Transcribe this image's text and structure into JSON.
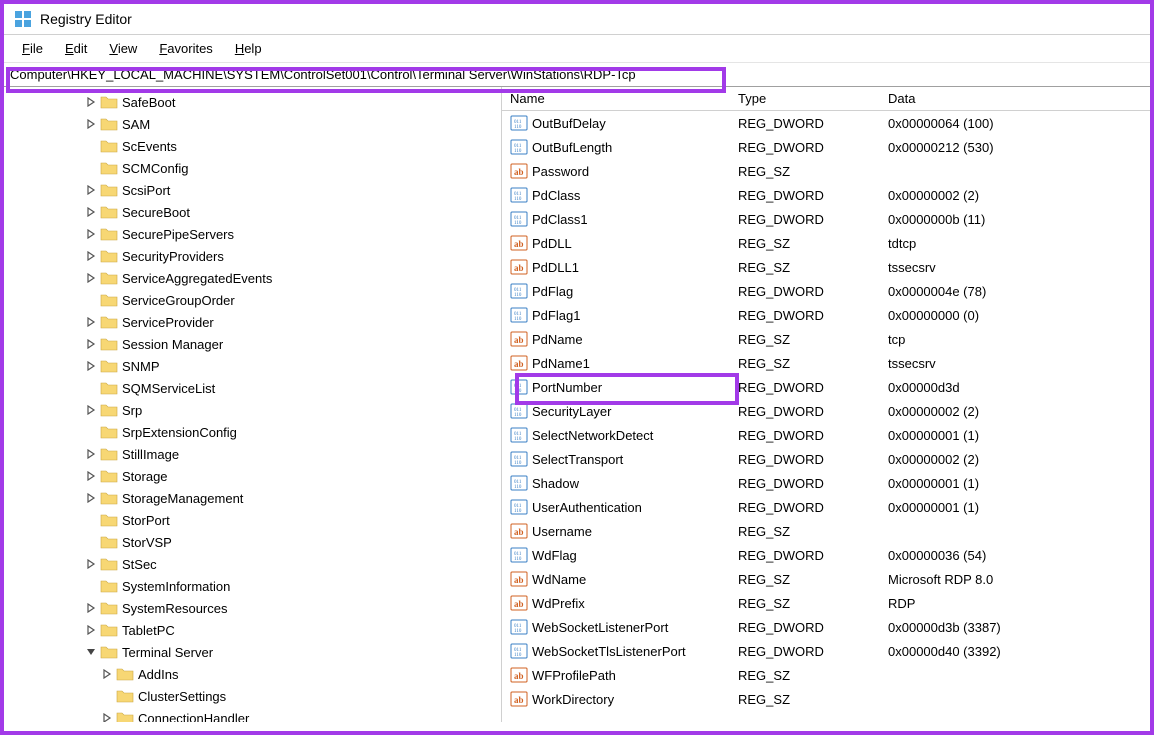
{
  "app": {
    "title": "Registry Editor"
  },
  "menu": {
    "file": "File",
    "edit": "Edit",
    "view": "View",
    "favorites": "Favorites",
    "help": "Help"
  },
  "address": "Computer\\HKEY_LOCAL_MACHINE\\SYSTEM\\ControlSet001\\Control\\Terminal Server\\WinStations\\RDP-Tcp",
  "columns": {
    "name": "Name",
    "type": "Type",
    "data": "Data"
  },
  "tree": [
    {
      "depth": 5,
      "exp": ">",
      "label": "SafeBoot"
    },
    {
      "depth": 5,
      "exp": ">",
      "label": "SAM"
    },
    {
      "depth": 5,
      "exp": "",
      "label": "ScEvents"
    },
    {
      "depth": 5,
      "exp": "",
      "label": "SCMConfig"
    },
    {
      "depth": 5,
      "exp": ">",
      "label": "ScsiPort"
    },
    {
      "depth": 5,
      "exp": ">",
      "label": "SecureBoot"
    },
    {
      "depth": 5,
      "exp": ">",
      "label": "SecurePipeServers"
    },
    {
      "depth": 5,
      "exp": ">",
      "label": "SecurityProviders"
    },
    {
      "depth": 5,
      "exp": ">",
      "label": "ServiceAggregatedEvents"
    },
    {
      "depth": 5,
      "exp": "",
      "label": "ServiceGroupOrder"
    },
    {
      "depth": 5,
      "exp": ">",
      "label": "ServiceProvider"
    },
    {
      "depth": 5,
      "exp": ">",
      "label": "Session Manager"
    },
    {
      "depth": 5,
      "exp": ">",
      "label": "SNMP"
    },
    {
      "depth": 5,
      "exp": "",
      "label": "SQMServiceList"
    },
    {
      "depth": 5,
      "exp": ">",
      "label": "Srp"
    },
    {
      "depth": 5,
      "exp": "",
      "label": "SrpExtensionConfig"
    },
    {
      "depth": 5,
      "exp": ">",
      "label": "StillImage"
    },
    {
      "depth": 5,
      "exp": ">",
      "label": "Storage"
    },
    {
      "depth": 5,
      "exp": ">",
      "label": "StorageManagement"
    },
    {
      "depth": 5,
      "exp": "",
      "label": "StorPort"
    },
    {
      "depth": 5,
      "exp": "",
      "label": "StorVSP"
    },
    {
      "depth": 5,
      "exp": ">",
      "label": "StSec"
    },
    {
      "depth": 5,
      "exp": "",
      "label": "SystemInformation"
    },
    {
      "depth": 5,
      "exp": ">",
      "label": "SystemResources"
    },
    {
      "depth": 5,
      "exp": ">",
      "label": "TabletPC"
    },
    {
      "depth": 5,
      "exp": "v",
      "label": "Terminal Server"
    },
    {
      "depth": 6,
      "exp": ">",
      "label": "AddIns"
    },
    {
      "depth": 6,
      "exp": "",
      "label": "ClusterSettings"
    },
    {
      "depth": 6,
      "exp": ">",
      "label": "ConnectionHandler"
    }
  ],
  "values": [
    {
      "icon": "bin",
      "name": "OutBufDelay",
      "type": "REG_DWORD",
      "data": "0x00000064 (100)"
    },
    {
      "icon": "bin",
      "name": "OutBufLength",
      "type": "REG_DWORD",
      "data": "0x00000212 (530)"
    },
    {
      "icon": "str",
      "name": "Password",
      "type": "REG_SZ",
      "data": ""
    },
    {
      "icon": "bin",
      "name": "PdClass",
      "type": "REG_DWORD",
      "data": "0x00000002 (2)"
    },
    {
      "icon": "bin",
      "name": "PdClass1",
      "type": "REG_DWORD",
      "data": "0x0000000b (11)"
    },
    {
      "icon": "str",
      "name": "PdDLL",
      "type": "REG_SZ",
      "data": "tdtcp"
    },
    {
      "icon": "str",
      "name": "PdDLL1",
      "type": "REG_SZ",
      "data": "tssecsrv"
    },
    {
      "icon": "bin",
      "name": "PdFlag",
      "type": "REG_DWORD",
      "data": "0x0000004e (78)"
    },
    {
      "icon": "bin",
      "name": "PdFlag1",
      "type": "REG_DWORD",
      "data": "0x00000000 (0)"
    },
    {
      "icon": "str",
      "name": "PdName",
      "type": "REG_SZ",
      "data": "tcp"
    },
    {
      "icon": "str",
      "name": "PdName1",
      "type": "REG_SZ",
      "data": "tssecsrv"
    },
    {
      "icon": "bin",
      "name": "PortNumber",
      "type": "REG_DWORD",
      "data": "0x00000d3d",
      "highlight": true
    },
    {
      "icon": "bin",
      "name": "SecurityLayer",
      "type": "REG_DWORD",
      "data": "0x00000002 (2)"
    },
    {
      "icon": "bin",
      "name": "SelectNetworkDetect",
      "type": "REG_DWORD",
      "data": "0x00000001 (1)"
    },
    {
      "icon": "bin",
      "name": "SelectTransport",
      "type": "REG_DWORD",
      "data": "0x00000002 (2)"
    },
    {
      "icon": "bin",
      "name": "Shadow",
      "type": "REG_DWORD",
      "data": "0x00000001 (1)"
    },
    {
      "icon": "bin",
      "name": "UserAuthentication",
      "type": "REG_DWORD",
      "data": "0x00000001 (1)"
    },
    {
      "icon": "str",
      "name": "Username",
      "type": "REG_SZ",
      "data": ""
    },
    {
      "icon": "bin",
      "name": "WdFlag",
      "type": "REG_DWORD",
      "data": "0x00000036 (54)"
    },
    {
      "icon": "str",
      "name": "WdName",
      "type": "REG_SZ",
      "data": "Microsoft RDP 8.0"
    },
    {
      "icon": "str",
      "name": "WdPrefix",
      "type": "REG_SZ",
      "data": "RDP"
    },
    {
      "icon": "bin",
      "name": "WebSocketListenerPort",
      "type": "REG_DWORD",
      "data": "0x00000d3b (3387)"
    },
    {
      "icon": "bin",
      "name": "WebSocketTlsListenerPort",
      "type": "REG_DWORD",
      "data": "0x00000d40 (3392)"
    },
    {
      "icon": "str",
      "name": "WFProfilePath",
      "type": "REG_SZ",
      "data": ""
    },
    {
      "icon": "str",
      "name": "WorkDirectory",
      "type": "REG_SZ",
      "data": ""
    }
  ]
}
